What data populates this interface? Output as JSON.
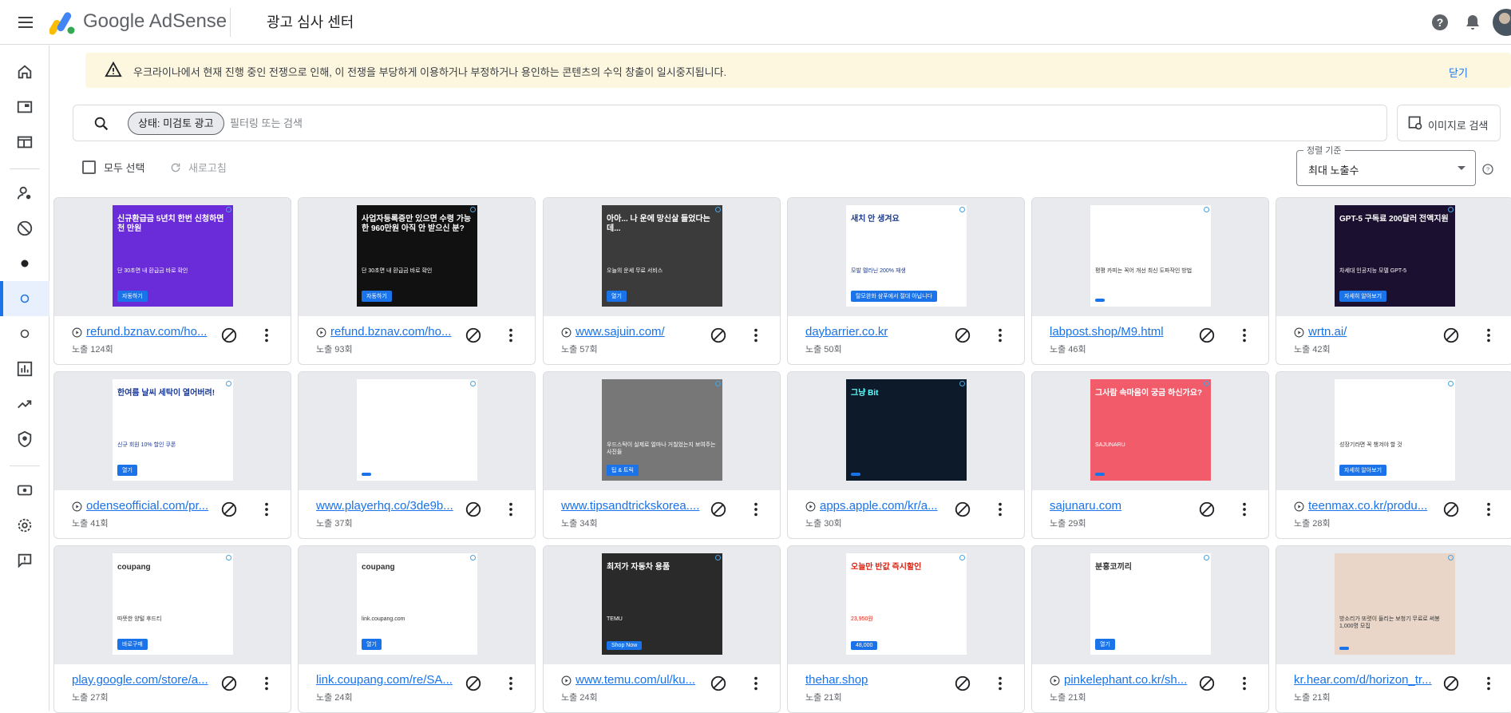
{
  "app": {
    "brand": "Google AdSense",
    "page_title": "광고 심사 센터"
  },
  "banner": {
    "text": "우크라이나에서 현재 진행 중인 전쟁으로 인해, 이 전쟁을 부당하게 이용하거나 부정하거나 용인하는 콘텐츠의 수익 창출이 일시중지됩니다.",
    "close": "닫기"
  },
  "search": {
    "chip": "상태: 미검토 광고",
    "placeholder": "필터링 또는 검색",
    "image_search": "이미지로 검색"
  },
  "toolbar": {
    "select_all": "모두 선택",
    "refresh": "새로고침",
    "sort_label": "정렬 기준",
    "sort_value": "최대 노출수"
  },
  "ads": [
    {
      "url": "refund.bznav.com/ho...",
      "imps": "노출 124회",
      "video": true,
      "creative": {
        "headline": "신규환급금 5년치 한번 신청하면 천 만원",
        "body": "단 30초면 내 환급금 바로 확인",
        "cta": "자동하기"
      }
    },
    {
      "url": "refund.bznav.com/ho...",
      "imps": "노출 93회",
      "video": true,
      "creative": {
        "headline": "사업자등록증만 있으면 수령 가능한 960만원 아직 안 받으신 분?",
        "body": "단 30초면 내 환급금 바로 확인",
        "cta": "자동하기"
      }
    },
    {
      "url": "www.sajuin.com/",
      "imps": "노출 57회",
      "video": true,
      "creative": {
        "headline": "아아... 나 운에 망신살 들었다는데...",
        "body": "오늘의 운세 무료 서비스",
        "cta": "열기"
      }
    },
    {
      "url": "daybarrier.co.kr",
      "imps": "노출 50회",
      "video": false,
      "creative": {
        "headline": "새치 안 생겨요",
        "body": "모발 멜라닌 200% 재생",
        "cta": "탈모완화 샴푸에서 절대 아닙니다"
      }
    },
    {
      "url": "labpost.shop/M9.html",
      "imps": "노출 46회",
      "video": false,
      "creative": {
        "headline": "",
        "body": "평평 카피는 꼭어 개선 최신 도파작인 방법",
        "cta": ""
      }
    },
    {
      "url": "wrtn.ai/",
      "imps": "노출 42회",
      "video": true,
      "creative": {
        "headline": "GPT-5 구독료 200달러 전액지원",
        "body": "차세대 인공지능 모델 GPT-5",
        "cta": "자세히 알아보기"
      }
    },
    {
      "url": "odenseofficial.com/pr...",
      "imps": "노출 41회",
      "video": true,
      "creative": {
        "headline": "한여름 날씨 세탁이 열어버려!",
        "body": "신규 회원 10% 할인 쿠폰",
        "cta": "열기"
      }
    },
    {
      "url": "www.playerhq.co/3de9b...",
      "imps": "노출 37회",
      "video": false,
      "creative": {
        "headline": "",
        "body": "",
        "cta": ""
      }
    },
    {
      "url": "www.tipsandtrickskorea....",
      "imps": "노출 34회",
      "video": false,
      "creative": {
        "headline": "",
        "body": "우드스탁이 실제로 얼마나 거칠었는지 보여주는 사진들",
        "cta": "팁 & 트릭"
      }
    },
    {
      "url": "apps.apple.com/kr/a...",
      "imps": "노출 30회",
      "video": true,
      "creative": {
        "headline": "그냥 Bit",
        "body": "",
        "cta": ""
      }
    },
    {
      "url": "sajunaru.com",
      "imps": "노출 29회",
      "video": false,
      "creative": {
        "headline": "그사람 속마음이 궁금 하신가요?",
        "body": "SAJUNARU",
        "cta": ""
      }
    },
    {
      "url": "teenmax.co.kr/produ...",
      "imps": "노출 28회",
      "video": true,
      "creative": {
        "headline": "",
        "body": "성장기라면 꼭 챙겨야 할 것",
        "cta": "자세히 알아보기"
      }
    },
    {
      "url": "play.google.com/store/a...",
      "imps": "노출 27회",
      "video": false,
      "creative": {
        "headline": "coupang",
        "body": "따뜻한 양털 후드티",
        "cta": "바로구매"
      }
    },
    {
      "url": "link.coupang.com/re/SA...",
      "imps": "노출 24회",
      "video": false,
      "creative": {
        "headline": "coupang",
        "body": "link.coupang.com",
        "cta": "열기"
      }
    },
    {
      "url": "www.temu.com/ul/ku...",
      "imps": "노출 24회",
      "video": true,
      "creative": {
        "headline": "최저가 자동차 용품",
        "body": "TEMU",
        "cta": "Shop Now"
      }
    },
    {
      "url": "thehar.shop",
      "imps": "노출 21회",
      "video": false,
      "creative": {
        "headline": "오늘만 반값 즉시할인",
        "body": "23,950원",
        "cta": "48,000"
      }
    },
    {
      "url": "pinkelephant.co.kr/sh...",
      "imps": "노출 21회",
      "video": true,
      "creative": {
        "headline": "분홍코끼리",
        "body": "",
        "cta": "열기"
      }
    },
    {
      "url": "kr.hear.com/d/horizon_tr...",
      "imps": "노출 21회",
      "video": false,
      "creative": {
        "headline": "",
        "body": "방소리가 또렷이 들리는 보청기 무료로 써봉 1,000명 모집",
        "cta": ""
      }
    }
  ]
}
